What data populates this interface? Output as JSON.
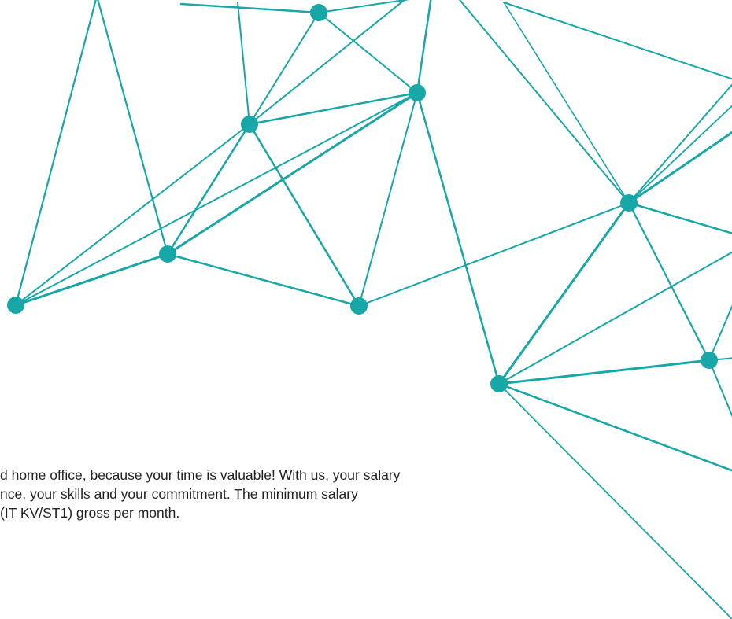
{
  "colors": {
    "network": "#16a7a6",
    "text": "#222222",
    "background": "#ffffff"
  },
  "text_block": {
    "lines": [
      "d home office, because your time is valuable! With us, your salary",
      "nce, your skills and your commitment. The minimum salary",
      "(IT KV/ST1) gross per month."
    ]
  }
}
